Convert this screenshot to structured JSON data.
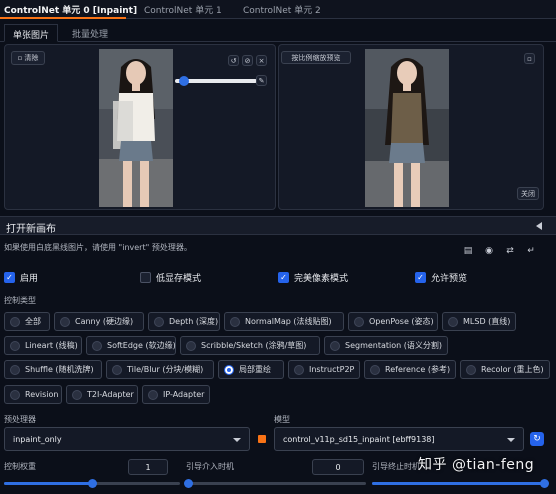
{
  "top_tabs": [
    "ControlNet 单元 0 [Inpaint]",
    "ControlNet 单元 1",
    "ControlNet 单元 2"
  ],
  "sub_tabs": [
    "单张图片",
    "批量处理"
  ],
  "left_panel": {
    "clear_label": "清除",
    "tool_icons": [
      "undo-icon",
      "clear-icon",
      "close-icon",
      "brush-icon"
    ]
  },
  "right_panel": {
    "top_button": "按比例缩放预览",
    "close_label": "关闭"
  },
  "open_canvas": "打开新画布",
  "hint": "如果使用白底黑线图片，请使用 \"invert\" 预处理器。",
  "checkboxes": [
    {
      "label": "启用",
      "checked": true
    },
    {
      "label": "低显存模式",
      "checked": false
    },
    {
      "label": "完美像素模式",
      "checked": true
    },
    {
      "label": "允许预览",
      "checked": true
    }
  ],
  "control_type_label": "控制类型",
  "control_types": [
    [
      "全部",
      "Canny (硬边缘)",
      "Depth (深度)",
      "NormalMap (法线贴图)",
      "OpenPose (姿态)",
      "MLSD (直线)"
    ],
    [
      "Lineart (线稿)",
      "SoftEdge (软边缘)",
      "Scribble/Sketch (涂鸦/草图)",
      "Segmentation (语义分割)"
    ],
    [
      "Shuffle (随机洗牌)",
      "Tile/Blur (分块/模糊)",
      "局部重绘",
      "InstructP2P",
      "Reference (参考)",
      "Recolor (重上色)"
    ],
    [
      "Revision",
      "T2I-Adapter",
      "IP-Adapter"
    ]
  ],
  "selected_control_type": "局部重绘",
  "preprocessor": {
    "label": "预处理器",
    "value": "inpaint_only"
  },
  "model": {
    "label": "模型",
    "value": "control_v11p_sd15_inpaint [ebff9138]"
  },
  "sliders": [
    {
      "label": "控制权重",
      "value": "1",
      "fraction": 0.5
    },
    {
      "label": "引导介入时机",
      "value": "0",
      "fraction": 0
    },
    {
      "label": "引导终止时机",
      "value": "1",
      "fraction": 1
    }
  ],
  "watermark": "知乎 @tian-feng",
  "colors": {
    "accent": "#2563eb",
    "tab_active": "#f97316",
    "background": "#0b0f19"
  }
}
